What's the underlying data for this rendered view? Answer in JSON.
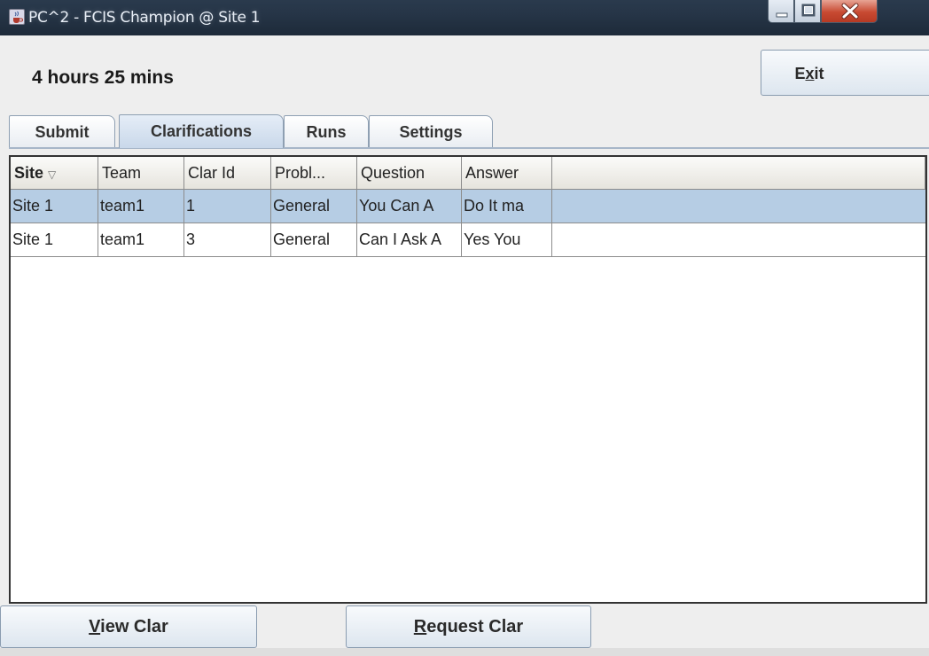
{
  "window": {
    "title": "PC^2 - FCIS Champion @ Site 1",
    "icon": "java-cup-icon"
  },
  "header": {
    "time_remaining": "4 hours 25 mins",
    "exit_label_pre": "E",
    "exit_label_u": "x",
    "exit_label_post": "it"
  },
  "tabs": [
    {
      "label": "Submit",
      "selected": false
    },
    {
      "label": "Clarifications",
      "selected": true
    },
    {
      "label": "Runs",
      "selected": false
    },
    {
      "label": "Settings",
      "selected": false
    }
  ],
  "table": {
    "columns": [
      "Site",
      "Team",
      "Clar Id",
      "Probl...",
      "Question",
      "Answer"
    ],
    "sort_indicator": "▽",
    "rows": [
      {
        "site": "Site 1",
        "team": "team1",
        "clar_id": "1",
        "problem": "General",
        "question": "You Can A",
        "answer": "Do It ma",
        "selected": true
      },
      {
        "site": "Site 1",
        "team": "team1",
        "clar_id": "3",
        "problem": "General",
        "question": "Can I Ask A",
        "answer": "Yes You",
        "selected": false
      }
    ]
  },
  "buttons": {
    "view_clar_u": "V",
    "view_clar_rest": "iew Clar",
    "request_clar_u": "R",
    "request_clar_rest": "equest Clar"
  },
  "colors": {
    "selected_row": "#b6cde4",
    "titlebar": "#263547",
    "close_button": "#c84a32"
  }
}
